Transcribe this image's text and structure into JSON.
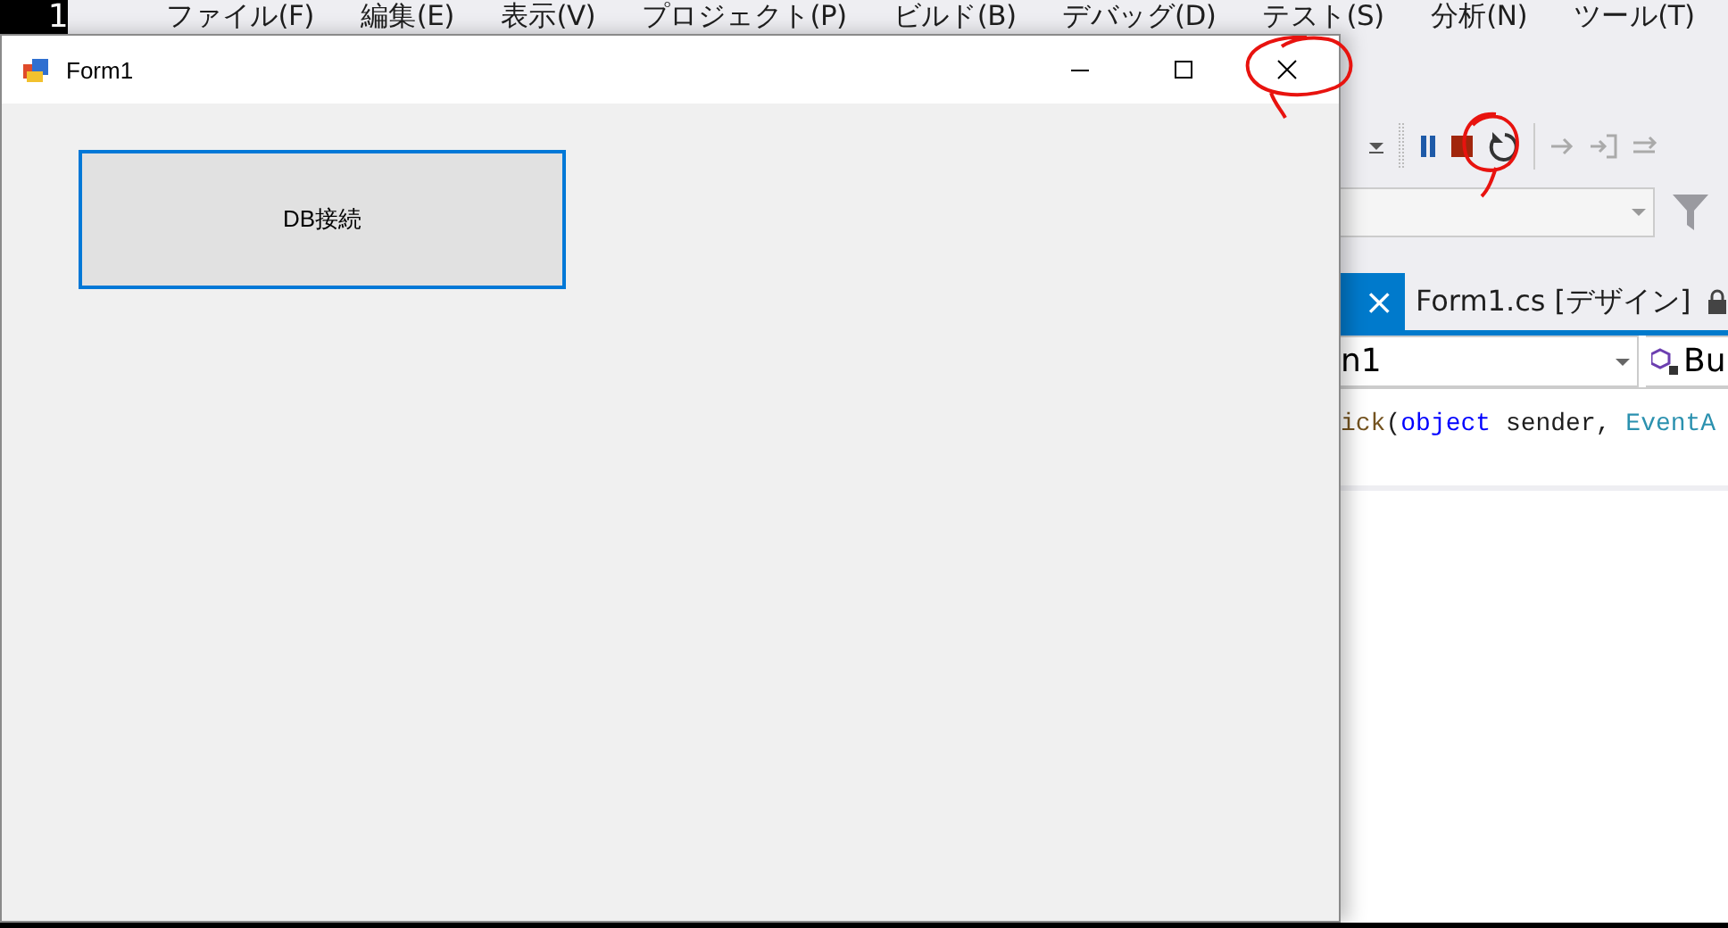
{
  "ide": {
    "corner_text": "1",
    "menu": [
      "ファイル(F)",
      "編集(E)",
      "表示(V)",
      "プロジェクト(P)",
      "ビルド(B)",
      "デバッグ(D)",
      "テスト(S)",
      "分析(N)",
      "ツール(T)"
    ],
    "tabs": [
      {
        "close": "×",
        "selected": true
      },
      {
        "label": "Form1.cs [デザイン]",
        "selected": false
      }
    ],
    "class_combo": "n1",
    "member_combo": "Bu",
    "code_line": [
      {
        "text": "ick",
        "kind": "method"
      },
      {
        "text": "(",
        "kind": "plain"
      },
      {
        "text": "object",
        "kind": "keyword"
      },
      {
        "text": " sender, ",
        "kind": "plain"
      },
      {
        "text": "EventA",
        "kind": "type"
      }
    ]
  },
  "form": {
    "title": "Form1",
    "button": {
      "label": "DB接続",
      "focused": true
    }
  }
}
